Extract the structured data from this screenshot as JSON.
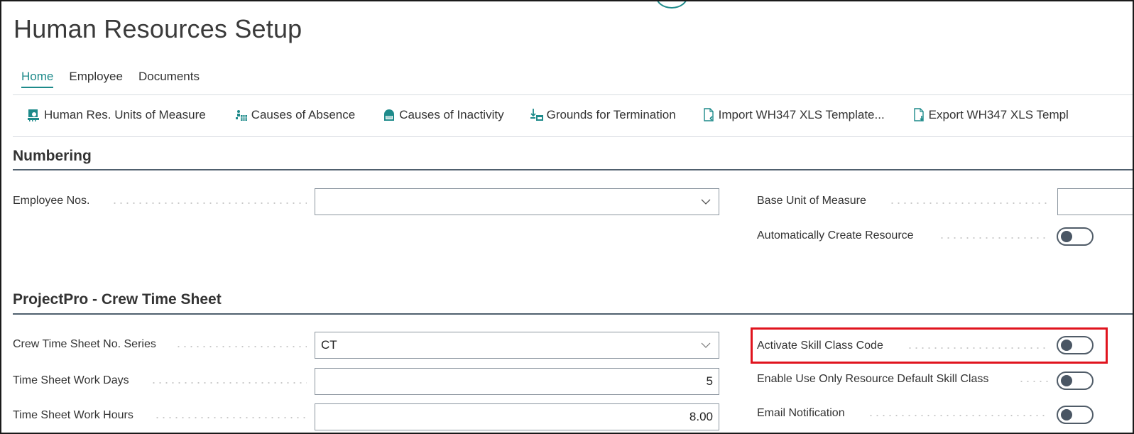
{
  "page": {
    "title": "Human Resources Setup"
  },
  "tabs": [
    {
      "label": "Home",
      "active": true
    },
    {
      "label": "Employee",
      "active": false
    },
    {
      "label": "Documents",
      "active": false
    }
  ],
  "actions": [
    {
      "label": "Human Res. Units of Measure",
      "icon": "units-of-measure-icon"
    },
    {
      "label": "Causes of Absence",
      "icon": "causes-of-absence-icon"
    },
    {
      "label": "Causes of Inactivity",
      "icon": "causes-of-inactivity-icon"
    },
    {
      "label": "Grounds for Termination",
      "icon": "grounds-for-termination-icon"
    },
    {
      "label": "Import WH347 XLS Template...",
      "icon": "import-document-icon"
    },
    {
      "label": "Export WH347 XLS Templ",
      "icon": "export-document-icon"
    }
  ],
  "sections": {
    "numbering": {
      "title": "Numbering",
      "employee_nos": {
        "label": "Employee Nos.",
        "value": ""
      },
      "base_unit_of_measure": {
        "label": "Base Unit of Measure",
        "value": ""
      },
      "auto_create_resource": {
        "label": "Automatically Create Resource",
        "value": false
      }
    },
    "crew_time_sheet": {
      "title": "ProjectPro - Crew Time Sheet",
      "no_series": {
        "label": "Crew Time Sheet No. Series",
        "value": "CT"
      },
      "work_days": {
        "label": "Time Sheet Work Days",
        "value": "5"
      },
      "work_hours": {
        "label": "Time Sheet Work Hours",
        "value": "8.00"
      },
      "activate_skill_class": {
        "label": "Activate Skill Class Code",
        "value": false,
        "highlighted": true
      },
      "default_skill_class_only": {
        "label": "Enable Use Only Resource Default Skill Class",
        "value": false
      },
      "email_notification": {
        "label": "Email Notification",
        "value": false
      }
    }
  },
  "colors": {
    "accent": "#1d8a8a",
    "highlight": "#e0141e",
    "toggle_off": "#4a5664"
  }
}
